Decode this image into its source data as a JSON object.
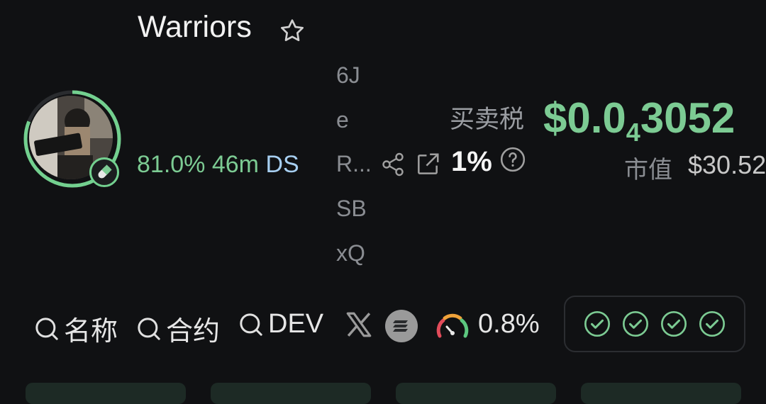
{
  "token": {
    "name": "Warriors",
    "stats": {
      "percent": "81.0%",
      "age": "46m",
      "tag": "DS"
    },
    "address_parts": [
      "6J",
      "e",
      "R...",
      "SB",
      "xQ"
    ]
  },
  "tax": {
    "label": "买卖税",
    "value": "1%"
  },
  "price": {
    "prefix": "$0.0",
    "zeros": "4",
    "digits": "3052"
  },
  "market_cap": {
    "label": "市值",
    "value": "$30.52"
  },
  "search": [
    {
      "label": "名称"
    },
    {
      "label": "合约"
    },
    {
      "label": "DEV"
    }
  ],
  "gauge_value": "0.8%",
  "icons": [
    "star-icon",
    "pill-icon",
    "share-icon",
    "external-link-icon",
    "help-icon",
    "search-icon",
    "x-logo-icon",
    "solana-icon",
    "gauge-icon",
    "check-circle-icon"
  ],
  "colors": {
    "accent_green": "#7ccb93",
    "accent_blue": "#a7cff1",
    "background": "#101113"
  }
}
